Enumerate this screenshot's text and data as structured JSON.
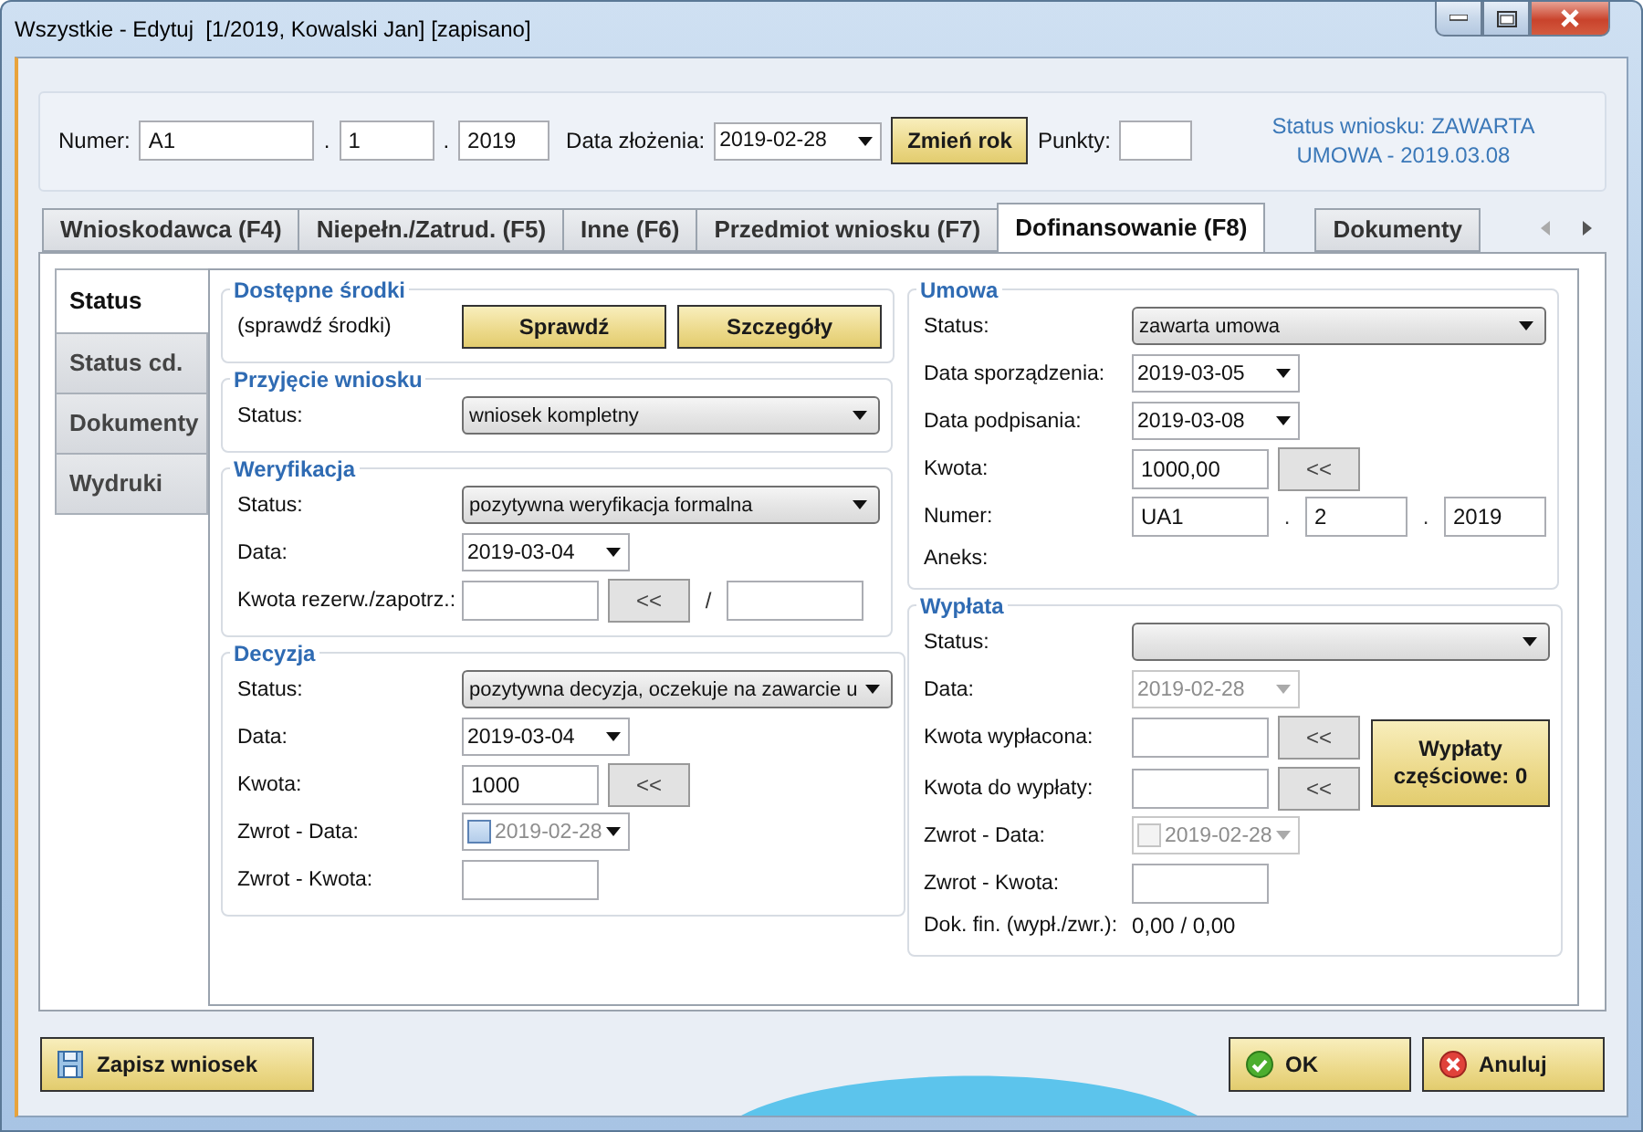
{
  "window": {
    "title": "Wszystkie - Edytuj  [1/2019, Kowalski Jan] [zapisano]"
  },
  "header": {
    "numer_label": "Numer:",
    "numer_parts": [
      "A1",
      "1",
      "2019"
    ],
    "separator": ".",
    "date_label": "Data złożenia:",
    "date_value": "2019-02-28",
    "change_year_button": "Zmień rok",
    "points_label": "Punkty:",
    "status_text": "Status wniosku: ZAWARTA UMOWA - 2019.03.08"
  },
  "tabs": [
    {
      "label": "Wnioskodawca (F4)",
      "selected": false
    },
    {
      "label": "Niepełn./Zatrud. (F5)",
      "selected": false
    },
    {
      "label": "Inne (F6)",
      "selected": false
    },
    {
      "label": "Przedmiot wniosku (F7)",
      "selected": false
    },
    {
      "label": "Dofinansowanie (F8)",
      "selected": true
    },
    {
      "label": "Dokumenty",
      "selected": false
    }
  ],
  "side_tabs": [
    {
      "label": "Status",
      "selected": true
    },
    {
      "label": "Status cd.",
      "selected": false
    },
    {
      "label": "Dokumenty",
      "selected": false
    },
    {
      "label": "Wydruki",
      "selected": false
    }
  ],
  "columns": [
    [
      {
        "title": "Dostępne środki",
        "rows": [
          {
            "kind": "buttons",
            "label": "(sprawdź środki)",
            "buttons": [
              "Sprawdź",
              "Szczegóły"
            ]
          }
        ]
      },
      {
        "title": "Przyjęcie wniosku",
        "rows": [
          {
            "kind": "select",
            "label": "Status:",
            "value": "wniosek kompletny"
          }
        ]
      },
      {
        "title": "Weryfikacja",
        "rows": [
          {
            "kind": "select",
            "label": "Status:",
            "value": "pozytywna weryfikacja formalna"
          },
          {
            "kind": "date",
            "label": "Data:",
            "value": "2019-03-04",
            "disabled": false
          },
          {
            "kind": "amount",
            "label": "Kwota rezerw./zapotrz.:",
            "button": "<<",
            "separator": "/"
          }
        ]
      },
      {
        "title": "Decyzja",
        "rows": [
          {
            "kind": "select",
            "label": "Status:",
            "value": "pozytywna decyzja, oczekuje na zawarcie u"
          },
          {
            "kind": "date",
            "label": "Data:",
            "value": "2019-03-04",
            "disabled": false
          },
          {
            "kind": "amount",
            "label": "Kwota:",
            "value": "1000",
            "button": "<<"
          },
          {
            "kind": "date",
            "label": "Zwrot - Data:",
            "value": "2019-02-28",
            "disabled": false,
            "checked": false
          },
          {
            "kind": "field",
            "label": "Zwrot - Kwota:"
          }
        ]
      }
    ],
    [
      {
        "title": "Umowa",
        "rows": [
          {
            "kind": "select",
            "label": "Status:",
            "value": "zawarta umowa"
          },
          {
            "kind": "date",
            "label": "Data sporządzenia:",
            "value": "2019-03-05",
            "disabled": false
          },
          {
            "kind": "date",
            "label": "Data podpisania:",
            "value": "2019-03-08",
            "disabled": false
          },
          {
            "kind": "amount",
            "label": "Kwota:",
            "value": "1000,00",
            "button": "<<"
          },
          {
            "kind": "number",
            "label": "Numer:",
            "parts": [
              "UA1",
              "2",
              "2019"
            ],
            "separator": "."
          },
          {
            "kind": "info",
            "label": "Aneks:"
          }
        ]
      },
      {
        "title": "Wypłata",
        "side_button": "Wypłaty częściowe: 0",
        "rows": [
          {
            "kind": "select",
            "label": "Status:"
          },
          {
            "kind": "date",
            "label": "Data:",
            "value": "2019-02-28",
            "disabled": true
          },
          {
            "kind": "amount",
            "label": "Kwota wypłacona:",
            "button": "<<",
            "side": true
          },
          {
            "kind": "amount",
            "label": "Kwota do wypłaty:",
            "button": "<<",
            "side": true
          },
          {
            "kind": "date",
            "label": "Zwrot - Data:",
            "value": "2019-02-28",
            "disabled": true,
            "checked": false
          },
          {
            "kind": "field",
            "label": "Zwrot - Kwota:"
          },
          {
            "kind": "info",
            "label": "Dok. fin. (wypł./zwr.):",
            "value": "0,00 / 0,00"
          }
        ]
      }
    ]
  ],
  "footer": {
    "save_button": "Zapisz wniosek",
    "ok_button": "OK",
    "cancel_button": "Anuluj"
  }
}
